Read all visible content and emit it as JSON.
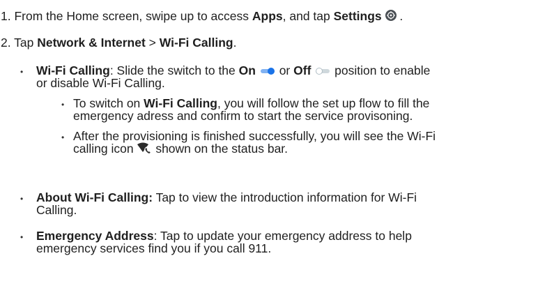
{
  "step1": {
    "num": "1.",
    "a": "From the Home screen, swipe up to access ",
    "apps": "Apps",
    "b": ", and tap ",
    "settings": "Settings",
    "c": "."
  },
  "step2": {
    "num": "2.",
    "a": "Tap ",
    "network": "Network & Internet",
    "b": " > ",
    "wifi": "Wi-Fi Calling",
    "c": "."
  },
  "bullet1": {
    "term": "Wi-Fi Calling",
    "a": ": Slide the switch to the ",
    "on": "On",
    "b": " or ",
    "off": "Off",
    "c": " position to enable",
    "line2": "or disable Wi-Fi Calling."
  },
  "sub1": {
    "a": "To switch on ",
    "term": "Wi-Fi Calling",
    "b": ", you will follow the set up flow to fill the",
    "line2": "emergency adress and confirm to start the service provisoning."
  },
  "sub2": {
    "line1": "After the provisioning is finished successfully, you will see the Wi-Fi",
    "a": "calling icon ",
    "b": " shown on the status bar."
  },
  "bullet2": {
    "term": "About Wi-Fi Calling:",
    "a": " Tap to view the introduction information for Wi-Fi",
    "line2": "Calling."
  },
  "bullet3": {
    "term": "Emergency Address",
    "a": ": Tap to update your emergency address to help",
    "line2": "emergency services find you if you call 911."
  },
  "bullet_char": "•",
  "colors": {
    "toggle_on": "#1a73e8",
    "toggle_off": "#cfd8dc",
    "text": "#1f1f1f"
  }
}
